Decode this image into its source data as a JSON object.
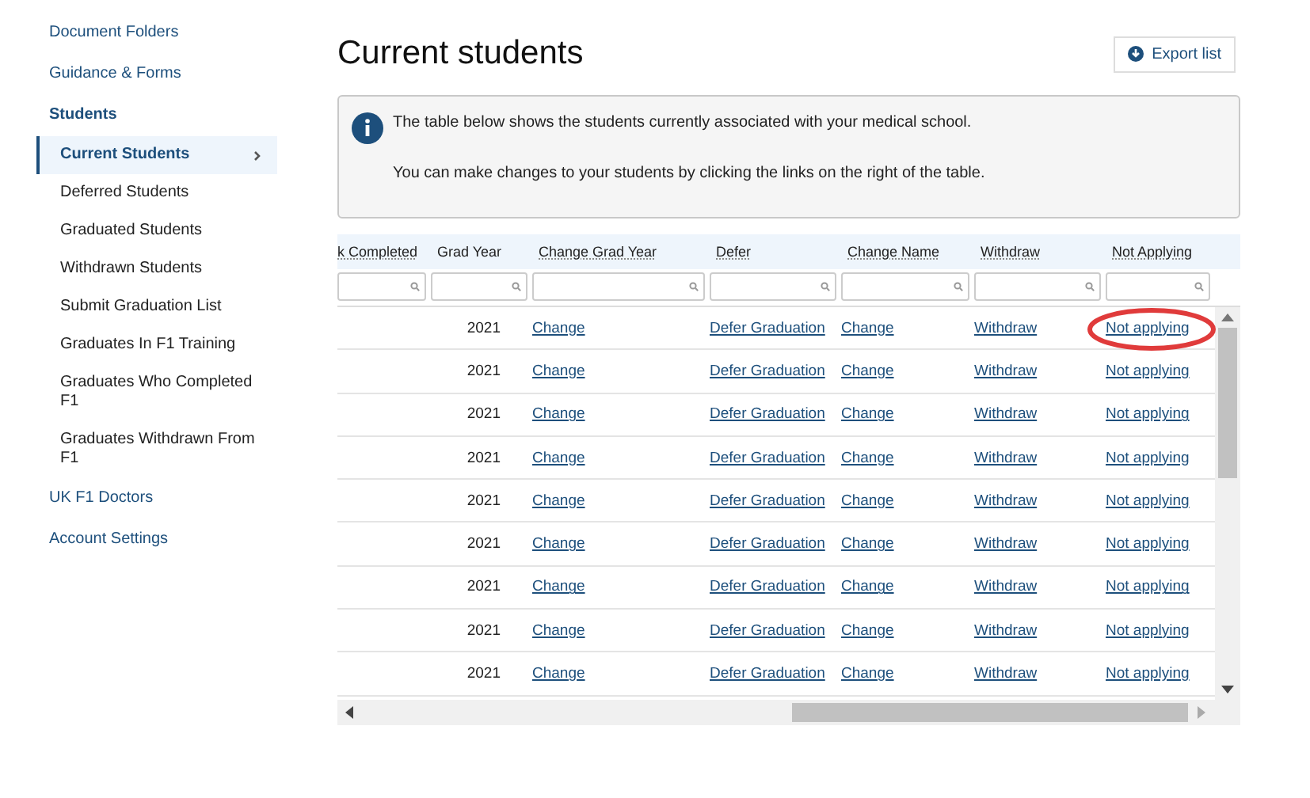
{
  "sidebar": {
    "items": [
      {
        "label": "Document Folders",
        "selected": false
      },
      {
        "label": "Guidance & Forms",
        "selected": false
      },
      {
        "label": "Students",
        "selected": false,
        "children": [
          {
            "label": "Current Students",
            "selected": true
          },
          {
            "label": "Deferred Students",
            "selected": false
          },
          {
            "label": "Graduated Students",
            "selected": false
          },
          {
            "label": "Withdrawn Students",
            "selected": false
          },
          {
            "label": "Submit Graduation List",
            "selected": false
          },
          {
            "label": "Graduates In F1 Training",
            "selected": false
          },
          {
            "label": "Graduates Who Completed F1",
            "selected": false
          },
          {
            "label": "Graduates Withdrawn From F1",
            "selected": false
          }
        ]
      },
      {
        "label": "UK F1 Doctors",
        "selected": false
      },
      {
        "label": "Account Settings",
        "selected": false
      }
    ]
  },
  "page": {
    "title": "Current students",
    "export_button": "Export list"
  },
  "info": [
    "The table below shows the students currently associated with your medical school.",
    "You can make changes to your students by clicking the links on the right of the table."
  ],
  "table": {
    "columns": [
      "k Completed",
      "Grad Year",
      "Change Grad Year",
      "Defer",
      "Change Name",
      "Withdraw",
      "Not Applying"
    ],
    "rows": [
      {
        "grad_year": "2021",
        "change_grad_year": "Change",
        "defer": "Defer Graduation",
        "change_name": "Change",
        "withdraw": "Withdraw",
        "not_applying": "Not applying",
        "circled": true
      },
      {
        "grad_year": "2021",
        "change_grad_year": "Change",
        "defer": "Defer Graduation",
        "change_name": "Change",
        "withdraw": "Withdraw",
        "not_applying": "Not applying",
        "circled": false
      },
      {
        "grad_year": "2021",
        "change_grad_year": "Change",
        "defer": "Defer Graduation",
        "change_name": "Change",
        "withdraw": "Withdraw",
        "not_applying": "Not applying",
        "circled": false
      },
      {
        "grad_year": "2021",
        "change_grad_year": "Change",
        "defer": "Defer Graduation",
        "change_name": "Change",
        "withdraw": "Withdraw",
        "not_applying": "Not applying",
        "circled": false
      },
      {
        "grad_year": "2021",
        "change_grad_year": "Change",
        "defer": "Defer Graduation",
        "change_name": "Change",
        "withdraw": "Withdraw",
        "not_applying": "Not applying",
        "circled": false
      },
      {
        "grad_year": "2021",
        "change_grad_year": "Change",
        "defer": "Defer Graduation",
        "change_name": "Change",
        "withdraw": "Withdraw",
        "not_applying": "Not applying",
        "circled": false
      },
      {
        "grad_year": "2021",
        "change_grad_year": "Change",
        "defer": "Defer Graduation",
        "change_name": "Change",
        "withdraw": "Withdraw",
        "not_applying": "Not applying",
        "circled": false
      },
      {
        "grad_year": "2021",
        "change_grad_year": "Change",
        "defer": "Defer Graduation",
        "change_name": "Change",
        "withdraw": "Withdraw",
        "not_applying": "Not applying",
        "circled": false
      },
      {
        "grad_year": "2021",
        "change_grad_year": "Change",
        "defer": "Defer Graduation",
        "change_name": "Change",
        "withdraw": "Withdraw",
        "not_applying": "Not applying",
        "circled": false
      }
    ]
  }
}
